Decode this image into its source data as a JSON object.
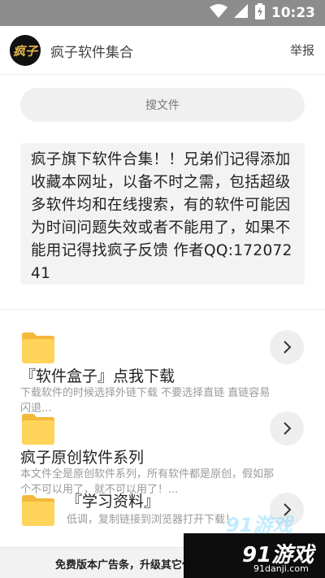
{
  "status_bar": {
    "time": "10:23",
    "icons": [
      "wifi-icon",
      "signal-icon",
      "battery-charging-icon"
    ]
  },
  "header": {
    "logo_text": "疯子",
    "title": "疯子软件集合",
    "report_label": "举报"
  },
  "search": {
    "placeholder": "搜文件"
  },
  "notice": {
    "text": "疯子旗下软件合集！！兄弟们记得添加收藏本网址，以备不时之需，包括超级多软件均和在线搜索，有的软件可能因为时间问题失效或者不能用了，如果不能用记得找疯子反馈 作者QQ:17207241"
  },
  "items": [
    {
      "title": "『软件盒子』点我下载",
      "desc": "下载软件的时候选择外链下载 不要选择直链 直链容易闪退...",
      "icon": "folder-icon"
    },
    {
      "title": "疯子原创软件系列",
      "desc": "本文件全是原创软件系列，所有软件都是原创，假如那个不可以用了，就不可以用了！...",
      "icon": "folder-icon"
    },
    {
      "title": "『学习资料』",
      "desc": "低调，复制链接到浏览器打开下载！",
      "icon": "folder-icon"
    }
  ],
  "ad_bar": {
    "text": "免费版本广告条，升级其它任一"
  },
  "watermark": {
    "brand": "91游戏",
    "ghost": "91游戏",
    "url": "91danji.com"
  },
  "colors": {
    "status_bar": "#8c8c8c",
    "folder": "#ffd45a",
    "card_bg": "#f3f3f3"
  }
}
